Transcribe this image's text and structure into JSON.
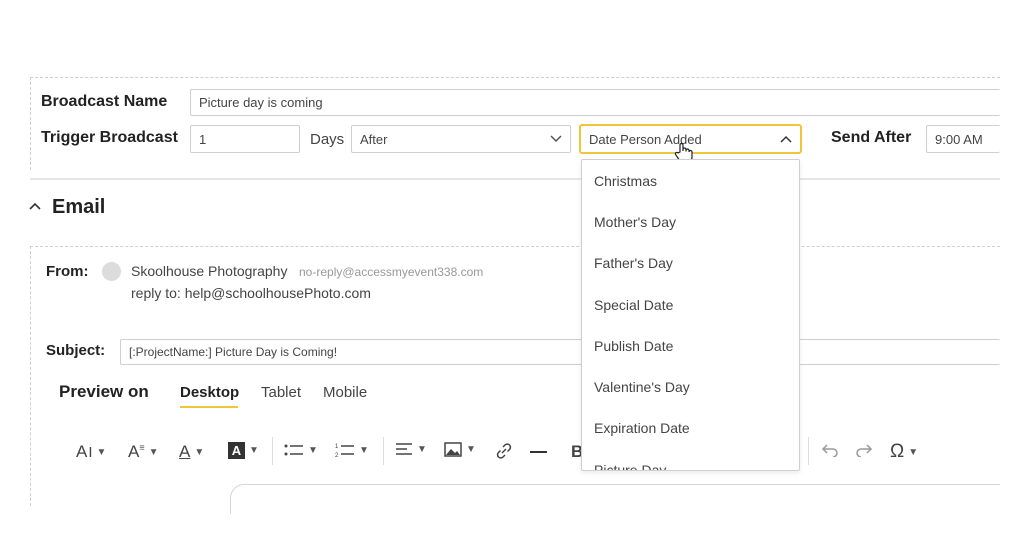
{
  "broadcast": {
    "name_label": "Broadcast Name",
    "name_value": "Picture day is coming",
    "trigger_label": "Trigger Broadcast",
    "trigger_value": "1",
    "days_label": "Days",
    "after_value": "After",
    "date_select_value": "Date Person Added",
    "send_after_label": "Send After",
    "send_after_value": "9:00 AM"
  },
  "date_menu": {
    "options": [
      "Christmas",
      "Mother's Day",
      "Father's Day",
      "Special Date",
      "Publish Date",
      "Valentine's Day",
      "Expiration Date",
      "Picture Day"
    ]
  },
  "email": {
    "section_title": "Email",
    "from_label": "From:",
    "sender_name": "Skoolhouse Photography",
    "sender_email": "no-reply@accessmyevent338.com",
    "reply_to": "reply to: help@schoolhousePhoto.com",
    "subject_label": "Subject:",
    "subject_value": "[:ProjectName:] Picture Day is Coming!",
    "preview_label": "Preview on",
    "tabs": [
      "Desktop",
      "Tablet",
      "Mobile"
    ]
  },
  "toolbar": {
    "icons": [
      "font-size-icon",
      "font-style-icon",
      "text-color-icon",
      "background-color-icon",
      "bullet-list-icon",
      "numbered-list-icon",
      "align-icon",
      "image-icon",
      "link-icon",
      "horizontal-rule-icon",
      "bold-icon",
      "undo-icon",
      "redo-icon",
      "special-character-icon"
    ]
  },
  "colors": {
    "accent": "#f2c43a"
  }
}
